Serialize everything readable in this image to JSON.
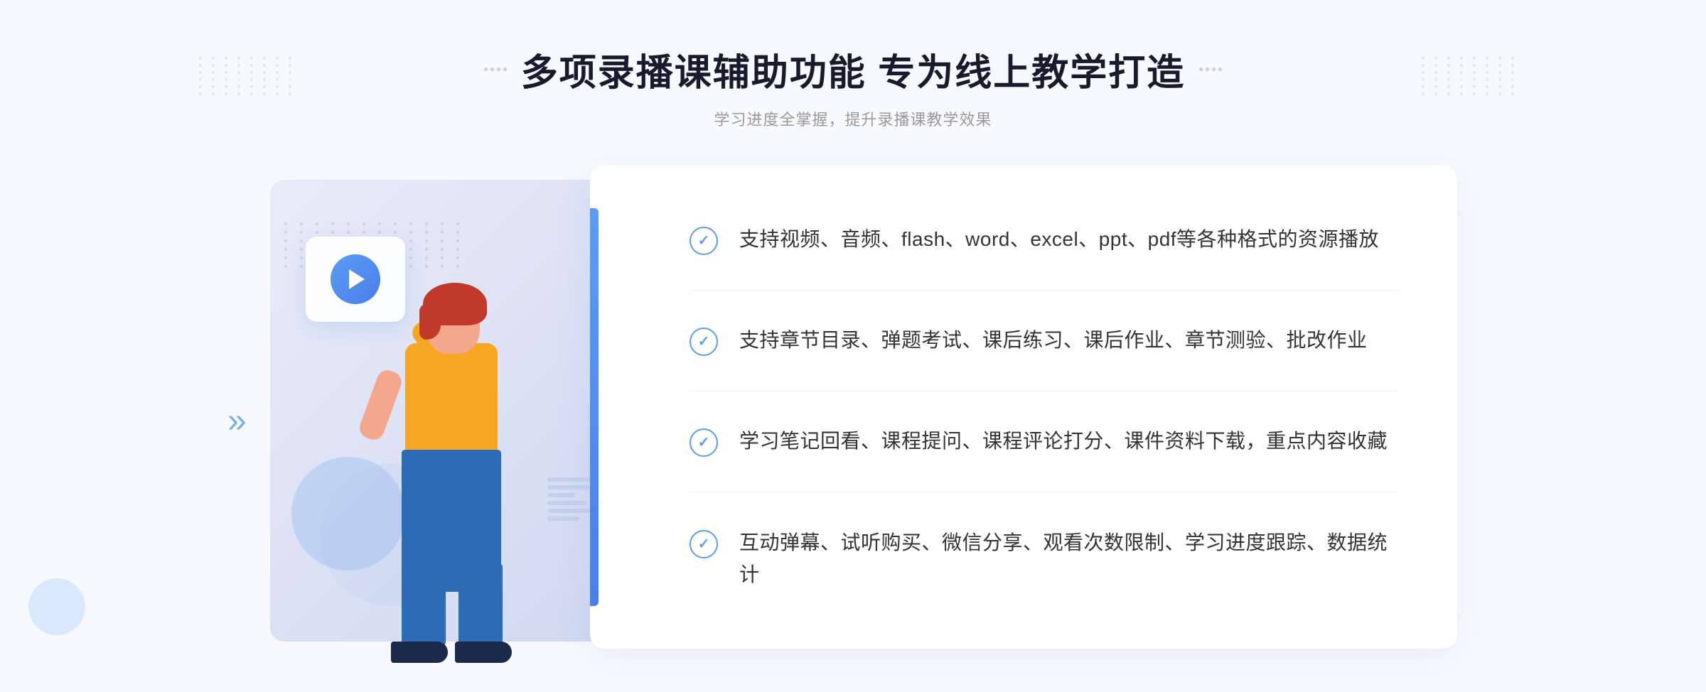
{
  "page": {
    "background": "#f4f6fc"
  },
  "header": {
    "title": "多项录播课辅助功能 专为线上教学打造",
    "subtitle": "学习进度全掌握，提升录播课教学效果"
  },
  "features": [
    {
      "id": "feature-1",
      "text": "支持视频、音频、flash、word、excel、ppt、pdf等各种格式的资源播放"
    },
    {
      "id": "feature-2",
      "text": "支持章节目录、弹题考试、课后练习、课后作业、章节测验、批改作业"
    },
    {
      "id": "feature-3",
      "text": "学习笔记回看、课程提问、课程评论打分、课件资料下载，重点内容收藏"
    },
    {
      "id": "feature-4",
      "text": "互动弹幕、试听购买、微信分享、观看次数限制、学习进度跟踪、数据统计"
    }
  ],
  "icons": {
    "play": "▶",
    "check": "✓",
    "chevron": "»"
  }
}
